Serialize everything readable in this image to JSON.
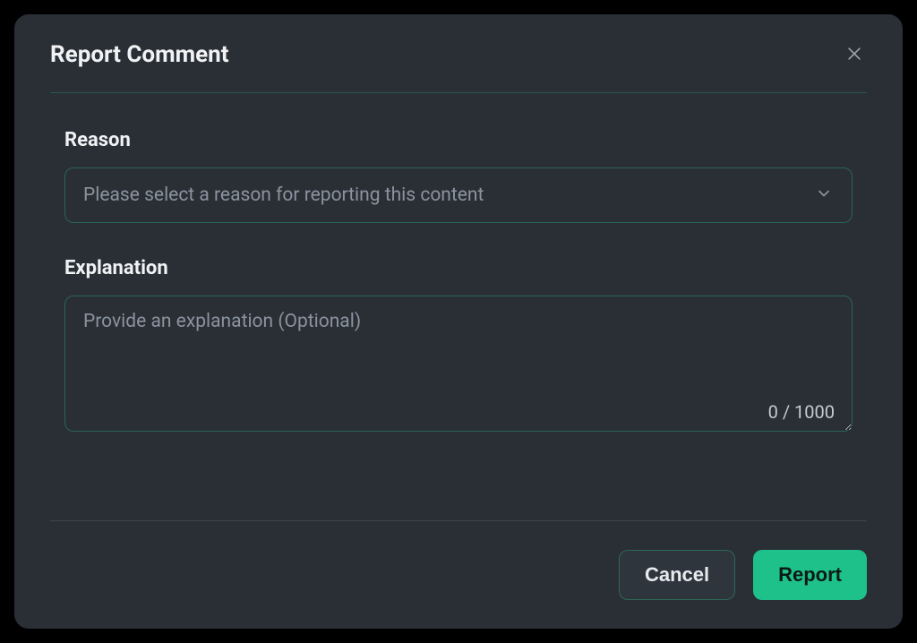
{
  "modal": {
    "title": "Report Comment",
    "reason": {
      "label": "Reason",
      "placeholder": "Please select a reason for reporting this content"
    },
    "explanation": {
      "label": "Explanation",
      "placeholder": "Provide an explanation (Optional)",
      "counter": "0 / 1000"
    },
    "buttons": {
      "cancel": "Cancel",
      "report": "Report"
    }
  }
}
